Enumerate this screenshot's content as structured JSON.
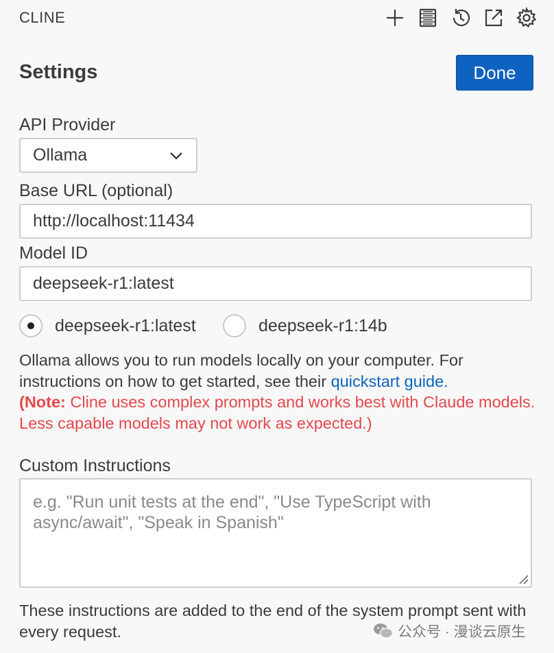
{
  "header": {
    "app_title": "CLINE",
    "actions": [
      {
        "name": "new-task",
        "icon": "plus-icon"
      },
      {
        "name": "mcp-servers",
        "icon": "server-icon"
      },
      {
        "name": "history",
        "icon": "history-icon"
      },
      {
        "name": "popout",
        "icon": "external-link-icon"
      },
      {
        "name": "settings",
        "icon": "gear-icon"
      }
    ]
  },
  "settings": {
    "title": "Settings",
    "done_label": "Done",
    "api_provider": {
      "label": "API Provider",
      "value": "Ollama"
    },
    "base_url": {
      "label": "Base URL (optional)",
      "value": "http://localhost:11434"
    },
    "model_id": {
      "label": "Model ID",
      "value": "deepseek-r1:latest"
    },
    "models": [
      {
        "label": "deepseek-r1:latest",
        "checked": true
      },
      {
        "label": "deepseek-r1:14b",
        "checked": false
      }
    ],
    "description": {
      "text": "Ollama allows you to run models locally on your computer. For instructions on how to get started, see their ",
      "link": "quickstart guide.",
      "note_bold": "(Note:",
      "note_rest": " Cline uses complex prompts and works best with Claude models. Less capable models may not work as expected.)"
    },
    "custom_instructions": {
      "label": "Custom Instructions",
      "placeholder": "e.g. \"Run unit tests at the end\", \"Use TypeScript with async/await\", \"Speak in Spanish\"",
      "value": "",
      "help": "These instructions are added to the end of the system prompt sent with every request."
    }
  },
  "watermark": {
    "text": "公众号 · 漫谈云原生",
    "icon": "wechat-icon"
  },
  "colors": {
    "primary": "#0f63c0",
    "note": "#e5484d",
    "background": "#f8f8f8"
  }
}
